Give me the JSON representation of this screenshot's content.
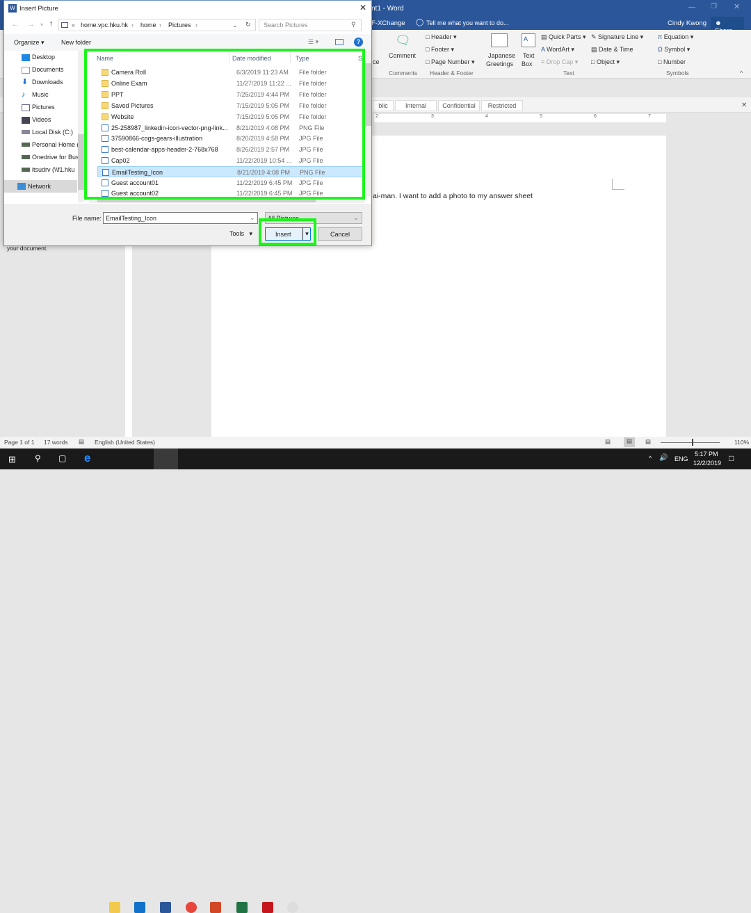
{
  "word": {
    "title": "nt1 - Word",
    "tab_partial": "F-XChange",
    "tell_me": "Tell me what you want to do...",
    "user": "Cindy Kwong",
    "share": "Share",
    "ribbon": {
      "comment": "Comment",
      "comments_group": "Comments",
      "header": "Header",
      "footer": "Footer",
      "page_number": "Page Number",
      "header_footer_group": "Header & Footer",
      "japanese_greetings_1": "Japanese",
      "japanese_greetings_2": "Greetings",
      "text_box_1": "Text",
      "text_box_2": "Box",
      "quick_parts": "Quick Parts",
      "wordart": "WordArt",
      "drop_cap": "Drop Cap",
      "signature_line": "Signature Line",
      "date_time": "Date & Time",
      "object": "Object",
      "text_group": "Text",
      "equation": "Equation",
      "symbol": "Symbol",
      "number": "Number",
      "symbols_group": "Symbols",
      "partial_left": "ce"
    },
    "classification": [
      "blic",
      "Internal",
      "Confidential",
      "Restricted"
    ],
    "ruler_ticks": [
      "2",
      "3",
      "4",
      "5",
      "6",
      "7"
    ],
    "document_text": "ai-man.  I want to add a photo to my answer sheet",
    "left_pane_text": "your document.",
    "status": {
      "page": "Page 1 of 1",
      "words": "17 words",
      "language": "English (United States)",
      "zoom": "110%"
    }
  },
  "taskbar": {
    "time": "5:17 PM",
    "date": "12/2/2019",
    "lang": "ENG"
  },
  "dialog": {
    "title": "Insert Picture",
    "breadcrumb": [
      "home.vpc.hku.hk",
      "home",
      "Pictures"
    ],
    "search_placeholder": "Search Pictures",
    "organize": "Organize",
    "new_folder": "New folder",
    "nav": [
      "Desktop",
      "Documents",
      "Downloads",
      "Music",
      "Pictures",
      "Videos",
      "Local Disk (C:)",
      "Personal Home (",
      "Onedrive for Bus",
      "itsudrv (\\\\f1.hku",
      "Network"
    ],
    "columns": {
      "name": "Name",
      "date": "Date modified",
      "type": "Type",
      "size": "S"
    },
    "files": [
      {
        "name": "Camera Roll",
        "date": "6/3/2019 11:23 AM",
        "type": "File folder",
        "kind": "folder"
      },
      {
        "name": "Online Exam",
        "date": "11/27/2019 11:22 ...",
        "type": "File folder",
        "kind": "folder"
      },
      {
        "name": "PPT",
        "date": "7/25/2019 4:44 PM",
        "type": "File folder",
        "kind": "folder"
      },
      {
        "name": "Saved Pictures",
        "date": "7/15/2019 5:05 PM",
        "type": "File folder",
        "kind": "folder"
      },
      {
        "name": "Website",
        "date": "7/15/2019 5:05 PM",
        "type": "File folder",
        "kind": "folder"
      },
      {
        "name": "25-258987_linkedin-icon-vector-png-link...",
        "date": "8/21/2019 4:08 PM",
        "type": "PNG File",
        "kind": "image"
      },
      {
        "name": "37590866-cogs-gears-illustration",
        "date": "8/20/2019 4:58 PM",
        "type": "JPG File",
        "kind": "image"
      },
      {
        "name": "best-calendar-apps-header-2-768x768",
        "date": "8/26/2019 2:57 PM",
        "type": "JPG File",
        "kind": "image"
      },
      {
        "name": "Cap02",
        "date": "11/22/2019 10:54 ...",
        "type": "JPG File",
        "kind": "image"
      },
      {
        "name": "EmailTesting_Icon",
        "date": "8/21/2019 4:08 PM",
        "type": "PNG File",
        "kind": "image",
        "selected": true
      },
      {
        "name": "Guest account01",
        "date": "11/22/2019 6:45 PM",
        "type": "JPG File",
        "kind": "image"
      },
      {
        "name": "Guest account02",
        "date": "11/22/2019 6:45 PM",
        "type": "JPG File",
        "kind": "image"
      }
    ],
    "file_name_label": "File name:",
    "file_name_value": "EmailTesting_Icon",
    "filter": "All Pictures",
    "tools": "Tools",
    "insert": "Insert",
    "cancel": "Cancel"
  },
  "colors": {
    "highlight": "#1cf51c",
    "word_blue": "#2b579a",
    "selection": "#cce8ff"
  }
}
